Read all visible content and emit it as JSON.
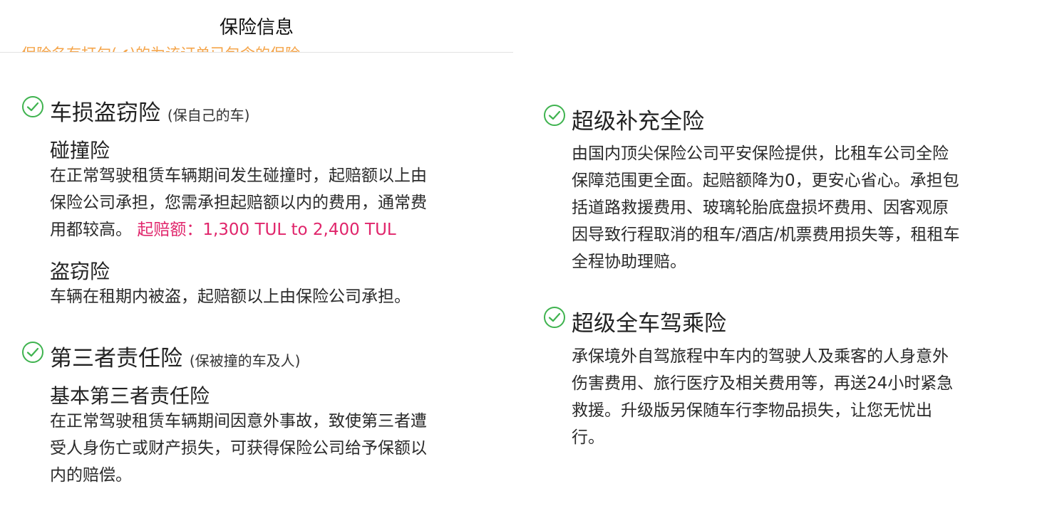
{
  "header": {
    "title": "保险信息",
    "notice": "保险名有打勾(✔)的为该订单已包含的保险"
  },
  "colors": {
    "check": "#3fb34f",
    "notice": "#f5a54a",
    "deductible": "#e0256b"
  },
  "left": {
    "theft": {
      "icon": "check-circle-icon",
      "title": "车损盗窃险",
      "subtitle": "(保自己的车)",
      "collision": {
        "title": "碰撞险",
        "lines": [
          "在正常驾驶租赁车辆期间发生碰撞时，起赔额以上由",
          "保险公司承担，您需承担起赔额以内的费用，通常费",
          "用都较高。"
        ],
        "deductible": "起赔额：1,300 TUL to 2,400 TUL"
      },
      "theft_cover": {
        "title": "盗窃险",
        "lines": [
          "车辆在租期内被盗，起赔额以上由保险公司承担。"
        ]
      }
    },
    "third_party": {
      "icon": "check-circle-icon",
      "title": "第三者责任险",
      "subtitle": "(保被撞的车及人)",
      "basic": {
        "title": "基本第三者责任险",
        "lines": [
          "在正常驾驶租赁车辆期间因意外事故，致使第三者遭",
          "受人身伤亡或财产损失，可获得保险公司给予保额以",
          "内的赔偿。"
        ]
      }
    }
  },
  "right": {
    "super_full": {
      "icon": "check-circle-icon",
      "title": "超级补充全险",
      "lines": [
        "由国内顶尖保险公司平安保险提供，比租车公司全险",
        "保障范围更全面。起赔额降为0，更安心省心。承担包",
        "括道路救援费用、玻璃轮胎底盘损坏费用、因客观原",
        "因导致行程取消的租车/酒店/机票费用损失等，租租车",
        "全程协助理赔。"
      ]
    },
    "super_passenger": {
      "icon": "check-circle-icon",
      "title": "超级全车驾乘险",
      "lines": [
        "承保境外自驾旅程中车内的驾驶人及乘客的人身意外",
        "伤害费用、旅行医疗及相关费用等，再送24小时紧急",
        "救援。升级版另保随车行李物品损失，让您无忧出",
        "行。"
      ]
    }
  }
}
